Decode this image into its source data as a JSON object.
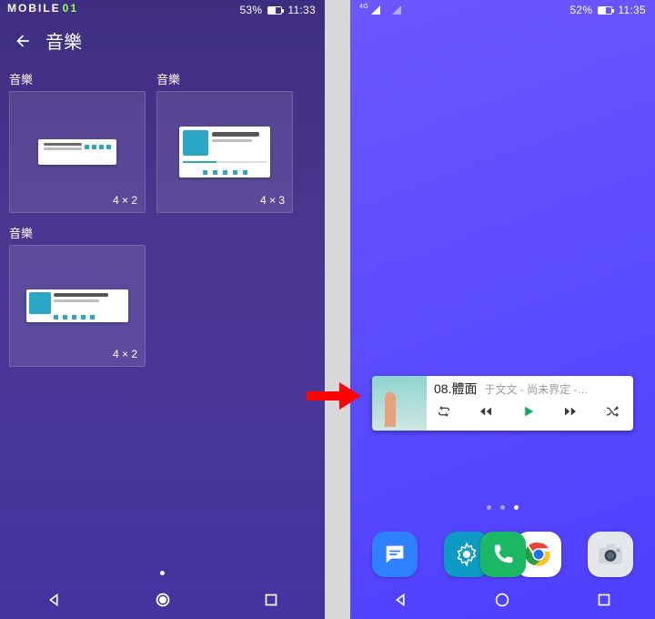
{
  "left": {
    "brand": "MOBILE",
    "brand_suffix": "01",
    "status": {
      "battery_pct": "53%",
      "time": "11:33",
      "battery_fill": 53
    },
    "header": {
      "title": "音樂"
    },
    "widgets": [
      {
        "label": "音樂",
        "size": "4 × 2"
      },
      {
        "label": "音樂",
        "size": "4 × 3"
      },
      {
        "label": "音樂",
        "size": "4 × 2"
      }
    ]
  },
  "right": {
    "status": {
      "net": "4G",
      "battery_pct": "52%",
      "time": "11:35",
      "battery_fill": 52
    },
    "music": {
      "track_no": "08.",
      "title": "體面",
      "meta": "于文文 - 尚未界定 -…"
    },
    "pager": {
      "count": 3,
      "active": 2
    },
    "dock": [
      "phone",
      "messages",
      "settings",
      "chrome",
      "camera"
    ]
  }
}
